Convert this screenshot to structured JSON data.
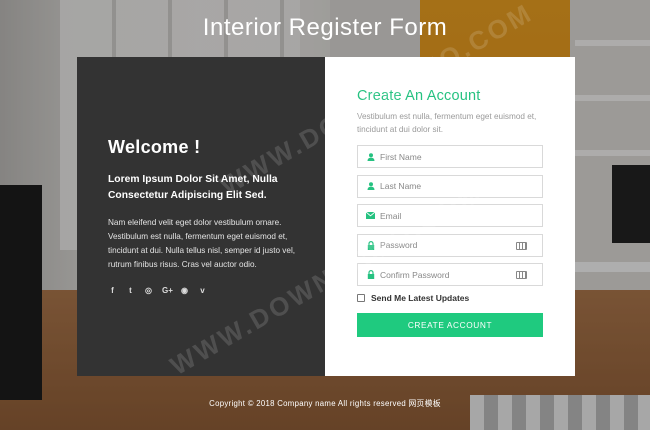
{
  "page": {
    "title": "Interior Register Form"
  },
  "welcome": {
    "heading": "Welcome !",
    "subheading": "Lorem Ipsum Dolor Sit Amet, Nulla Consectetur Adipiscing Elit Sed.",
    "body": "Nam eleifend velit eget dolor vestibulum ornare. Vestibulum est nulla, fermentum eget euismod et, tincidunt at dui. Nulla tellus nisl, semper id justo vel, rutrum finibus risus. Cras vel auctor odio.",
    "socials": [
      {
        "name": "facebook",
        "glyph": "f"
      },
      {
        "name": "twitter",
        "glyph": "t"
      },
      {
        "name": "instagram",
        "glyph": "◎"
      },
      {
        "name": "google-plus",
        "glyph": "G+"
      },
      {
        "name": "dribbble",
        "glyph": "◉"
      },
      {
        "name": "vimeo",
        "glyph": "v"
      }
    ]
  },
  "form": {
    "title": "Create An Account",
    "description": "Vestibulum est nulla, fermentum eget euismod et, tincidunt at dui dolor sit.",
    "fields": {
      "first_name": {
        "placeholder": "First Name",
        "icon": "user-icon"
      },
      "last_name": {
        "placeholder": "Last Name",
        "icon": "user-icon"
      },
      "email": {
        "placeholder": "Email",
        "icon": "envelope-icon"
      },
      "password": {
        "placeholder": "Password",
        "icon": "lock-icon"
      },
      "confirm_password": {
        "placeholder": "Confirm Password",
        "icon": "lock-icon"
      }
    },
    "checkbox_label": "Send Me Latest Updates",
    "submit_label": "CREATE ACCOUNT"
  },
  "footer": {
    "text": "Copyright © 2018 Company name All rights reserved 网页模板"
  },
  "watermark": [
    "WWW.DOWNDEMO.COM",
    "WWW.DOWNDEMO.COM"
  ],
  "colors": {
    "accent": "#26c281",
    "button": "#1fca7f",
    "left_panel": "#333333"
  }
}
